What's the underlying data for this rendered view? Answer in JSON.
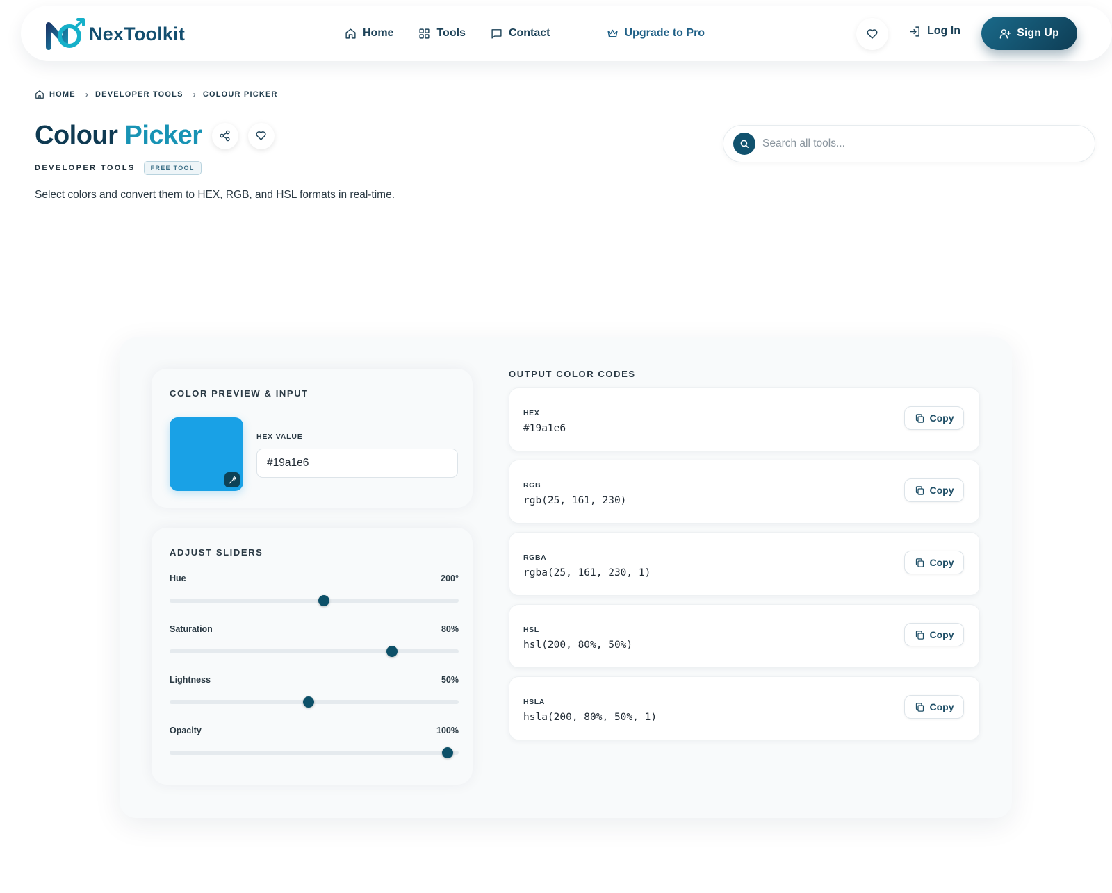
{
  "brand": {
    "name": "NexToolkit"
  },
  "nav": {
    "links": [
      {
        "label": "Home",
        "icon": "home-icon"
      },
      {
        "label": "Tools",
        "icon": "grid-icon"
      },
      {
        "label": "Contact",
        "icon": "message-icon"
      }
    ],
    "pro_label": "Upgrade to Pro",
    "login_label": "Log In",
    "signup_label": "Sign Up"
  },
  "breadcrumb": [
    "HOME",
    "DEVELOPER TOOLS",
    "COLOUR PICKER"
  ],
  "page": {
    "title_part1": "Colour",
    "title_part2": "Picker",
    "category": "DEVELOPER TOOLS",
    "badge": "FREE TOOL",
    "description": "Select colors and convert them to HEX, RGB, and HSL formats in real-time."
  },
  "search": {
    "placeholder": "Search all tools..."
  },
  "preview": {
    "heading": "COLOR PREVIEW & INPUT",
    "hex_label": "HEX VALUE",
    "hex_value": "#19a1e6",
    "swatch_color": "#19a1e6"
  },
  "sliders": {
    "heading": "ADJUST SLIDERS",
    "items": [
      {
        "label": "Hue",
        "value": "200°",
        "fraction": 0.556
      },
      {
        "label": "Saturation",
        "value": "80%",
        "fraction": 0.8
      },
      {
        "label": "Lightness",
        "value": "50%",
        "fraction": 0.5
      },
      {
        "label": "Opacity",
        "value": "100%",
        "fraction": 1.0
      }
    ]
  },
  "outputs": {
    "heading": "OUTPUT COLOR CODES",
    "copy_label": "Copy",
    "items": [
      {
        "label": "HEX",
        "value": "#19a1e6"
      },
      {
        "label": "RGB",
        "value": "rgb(25, 161, 230)"
      },
      {
        "label": "RGBA",
        "value": "rgba(25, 161, 230, 1)"
      },
      {
        "label": "HSL",
        "value": "hsl(200, 80%, 50%)"
      },
      {
        "label": "HSLA",
        "value": "hsla(200, 80%, 50%, 1)"
      }
    ]
  },
  "colors": {
    "accent": "#19a1e6",
    "brand_dark": "#0f3a52",
    "brand_teal": "#1893b4"
  }
}
